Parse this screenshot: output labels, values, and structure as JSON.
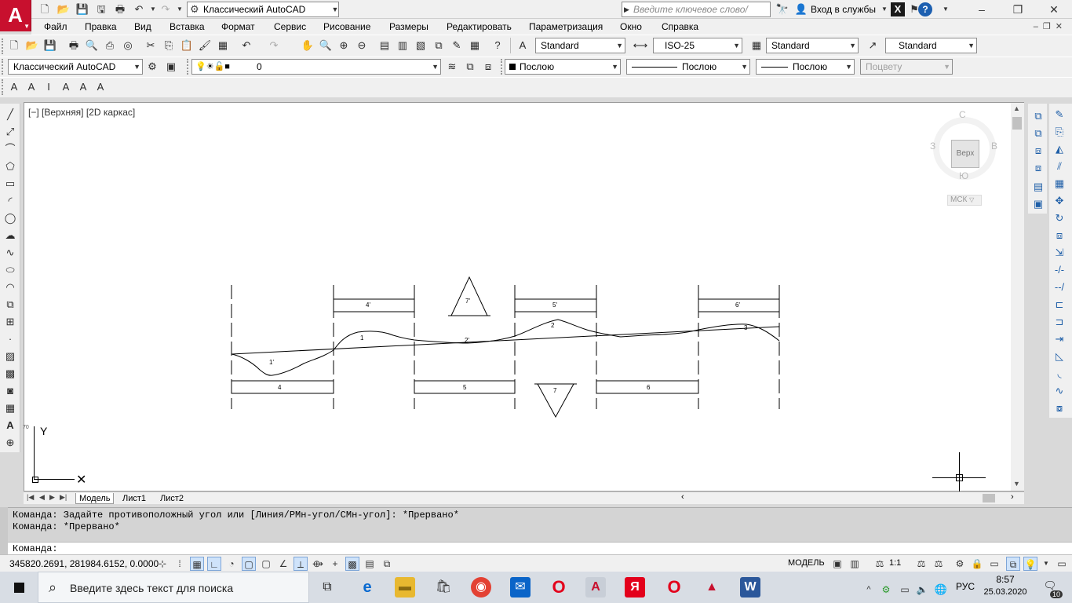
{
  "app": {
    "logo_letter": "A",
    "workspace": "Классический AutoCAD",
    "search_placeholder": "Введите ключевое слово/фразу",
    "login": "Вход в службы",
    "xchange_label": "X",
    "help_label": "?"
  },
  "menu": [
    "Файл",
    "Правка",
    "Вид",
    "Вставка",
    "Формат",
    "Сервис",
    "Рисование",
    "Размеры",
    "Редактировать",
    "Параметризация",
    "Окно",
    "Справка"
  ],
  "styles": {
    "text_style": "Standard",
    "dim_style": "ISO-25",
    "table_style": "Standard",
    "mleader_style": "Standard"
  },
  "layers": {
    "workspace_combo": "Классический AutoCAD",
    "current_layer": "0",
    "color": "Послою",
    "linetype": "Послою",
    "lineweight": "Послою",
    "plotstyle": "Поцвету"
  },
  "viewport": {
    "label": "[−] [Верхняя] [2D каркас]",
    "cube_face": "Верх",
    "north": "С",
    "south": "Ю",
    "west": "З",
    "east": "В",
    "wcs": "МСК",
    "ucs_y": "Y",
    "ruler_mark": "70"
  },
  "drawing_labels": {
    "top_boxes": [
      "4'",
      "5'",
      "6'"
    ],
    "bottom_boxes": [
      "4",
      "5",
      "6"
    ],
    "curve_labels": [
      "1'",
      "1",
      "2'",
      "2",
      "3"
    ],
    "triangle_up": "7'",
    "triangle_down": "7"
  },
  "tabs": [
    "Модель",
    "Лист1",
    "Лист2"
  ],
  "command": {
    "history": [
      "Команда: Задайте противоположный угол или [Линия/РМн-угол/СМн-угол]: *Прервано*",
      "Команда: *Прервано*"
    ],
    "prompt": "Команда:"
  },
  "status": {
    "coords": "345820.2691, 281984.6152, 0.0000",
    "model": "МОДЕЛЬ",
    "scale": "1:1"
  },
  "taskbar": {
    "search_text": "Введите здесь текст для поиска",
    "lang": "РУС",
    "time": "8:57",
    "date": "25.03.2020",
    "notifications": "10"
  },
  "colors": {
    "autocad_red": "#c8102e",
    "toolbar_bg": "#f0f0f0",
    "canvas": "#ffffff"
  }
}
